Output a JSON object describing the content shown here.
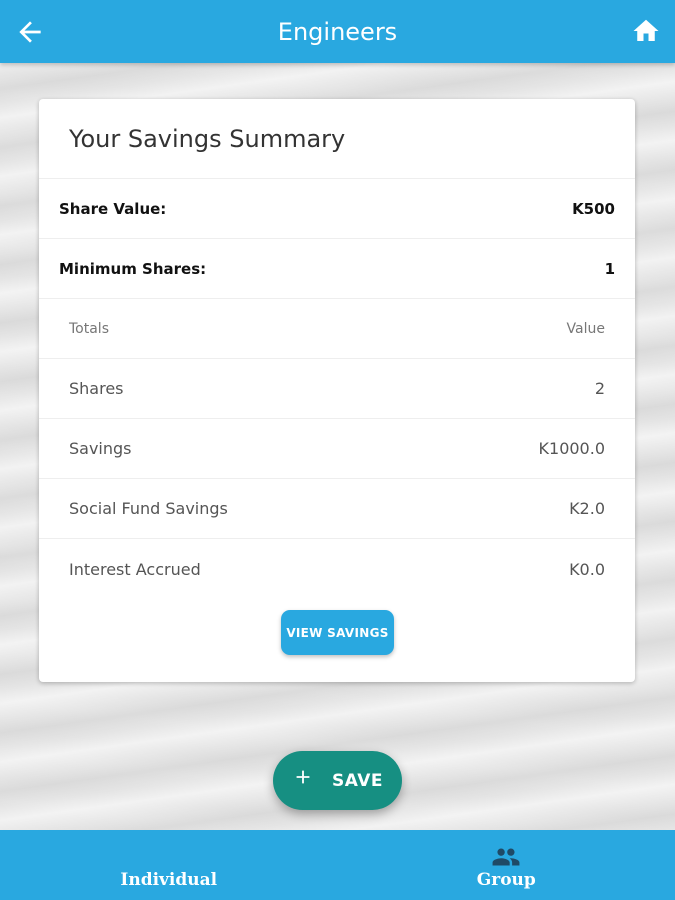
{
  "appbar": {
    "title": "Engineers",
    "back_icon": "arrow-left-icon",
    "home_icon": "home-icon",
    "color": "#29a8e0"
  },
  "card": {
    "title": "Your Savings Summary",
    "info": [
      {
        "label": "Share Value:",
        "value": "K500"
      },
      {
        "label": "Minimum Shares:",
        "value": "1"
      }
    ],
    "table": {
      "headers": {
        "label": "Totals",
        "value": "Value"
      },
      "rows": [
        {
          "label": "Shares",
          "value": "2"
        },
        {
          "label": "Savings",
          "value": "K1000.0"
        },
        {
          "label": "Social Fund Savings",
          "value": "K2.0"
        },
        {
          "label": "Interest Accrued",
          "value": "K0.0"
        }
      ]
    },
    "view_button": "VIEW SAVINGS"
  },
  "fab": {
    "icon": "plus-icon",
    "label": "SAVE",
    "color": "#168f82"
  },
  "bottom_nav": {
    "items": [
      {
        "label": "Individual"
      },
      {
        "label": "Group",
        "icon": "group-icon"
      }
    ]
  }
}
